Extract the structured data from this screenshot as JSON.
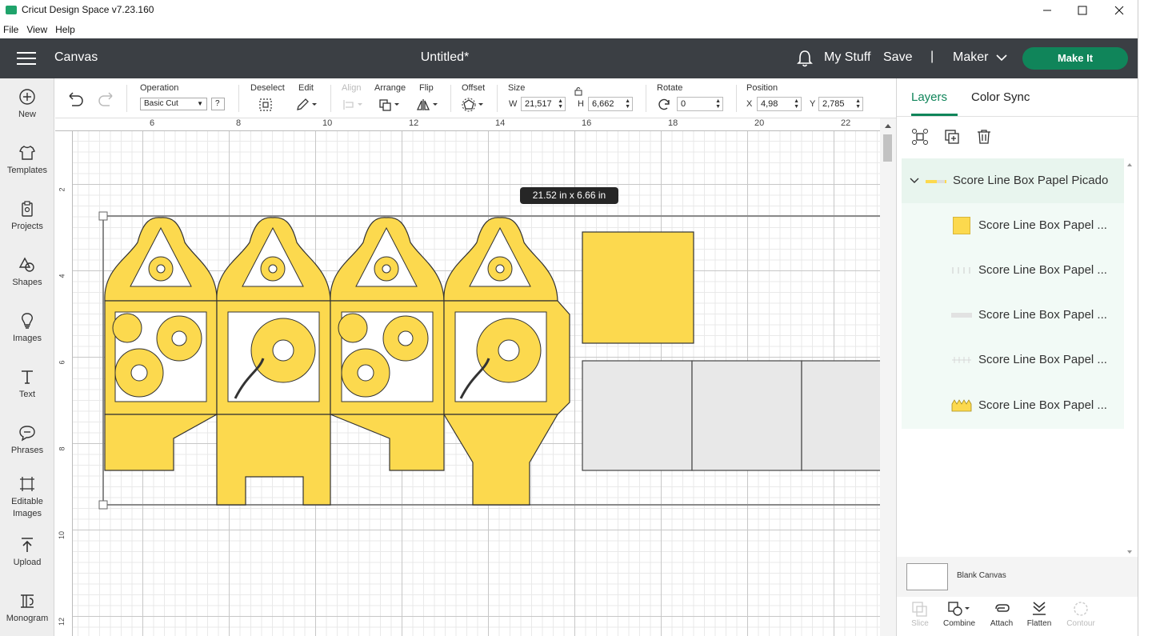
{
  "window": {
    "title": "Cricut Design Space  v7.23.160",
    "controls": [
      "minimize",
      "maximize",
      "close"
    ]
  },
  "menubar": [
    "File",
    "View",
    "Help"
  ],
  "header": {
    "section": "Canvas",
    "doc_title": "Untitled*",
    "my_stuff": "My Stuff",
    "save": "Save",
    "separator": "|",
    "machine": "Maker",
    "make_it": "Make It",
    "accent_color": "#10855a"
  },
  "sidebar": {
    "items": [
      {
        "label": "New",
        "icon": "plus-circle-icon"
      },
      {
        "label": "Templates",
        "icon": "tshirt-icon"
      },
      {
        "label": "Projects",
        "icon": "clipboard-icon"
      },
      {
        "label": "Shapes",
        "icon": "shapes-icon"
      },
      {
        "label": "Images",
        "icon": "lightbulb-icon"
      },
      {
        "label": "Text",
        "icon": "text-t-icon"
      },
      {
        "label": "Phrases",
        "icon": "speech-bubble-icon"
      },
      {
        "label": "Editable\nImages",
        "label_line1": "Editable",
        "label_line2": "Images",
        "icon": "editable-images-icon"
      },
      {
        "label": "Upload",
        "icon": "upload-arrow-icon"
      },
      {
        "label": "Monogram",
        "icon": "monogram-icon"
      }
    ]
  },
  "toolbar": {
    "operation_label": "Operation",
    "operation_value": "Basic Cut",
    "help": "?",
    "deselect_label": "Deselect",
    "edit_label": "Edit",
    "align_label": "Align",
    "arrange_label": "Arrange",
    "flip_label": "Flip",
    "offset_label": "Offset",
    "size_label": "Size",
    "w_label": "W",
    "w_value": "21,517",
    "h_label": "H",
    "h_value": "6,662",
    "rotate_label": "Rotate",
    "rotate_value": "0",
    "position_label": "Position",
    "x_label": "X",
    "x_value": "4,98",
    "y_label": "Y",
    "y_value": "2,785"
  },
  "canvas": {
    "ruler_top": [
      "6",
      "8",
      "10",
      "12",
      "14",
      "16",
      "18",
      "20",
      "22"
    ],
    "ruler_left": [
      "2",
      "4",
      "6",
      "8",
      "10",
      "12"
    ],
    "size_tooltip": "21.52  in x 6.66  in",
    "design_color": "#fcd94e",
    "score_panel_color": "#e8e8e8"
  },
  "panel": {
    "tabs": [
      "Layers",
      "Color Sync"
    ],
    "group_name": "Score Line Box Papel Picado",
    "layers": [
      {
        "name": "Score Line Box Papel ...",
        "thumb": "yellow-square"
      },
      {
        "name": "Score Line Box Papel ...",
        "thumb": "score-lines"
      },
      {
        "name": "Score Line Box Papel ...",
        "thumb": "grey-panel"
      },
      {
        "name": "Score Line Box Papel ...",
        "thumb": "score-lines-small"
      },
      {
        "name": "Score Line Box Papel ...",
        "thumb": "yellow-box"
      }
    ],
    "blank_canvas": "Blank Canvas",
    "bottom_tools": [
      {
        "label": "Slice",
        "enabled": false
      },
      {
        "label": "Combine",
        "enabled": true
      },
      {
        "label": "Attach",
        "enabled": true
      },
      {
        "label": "Flatten",
        "enabled": true
      },
      {
        "label": "Contour",
        "enabled": false
      }
    ]
  }
}
